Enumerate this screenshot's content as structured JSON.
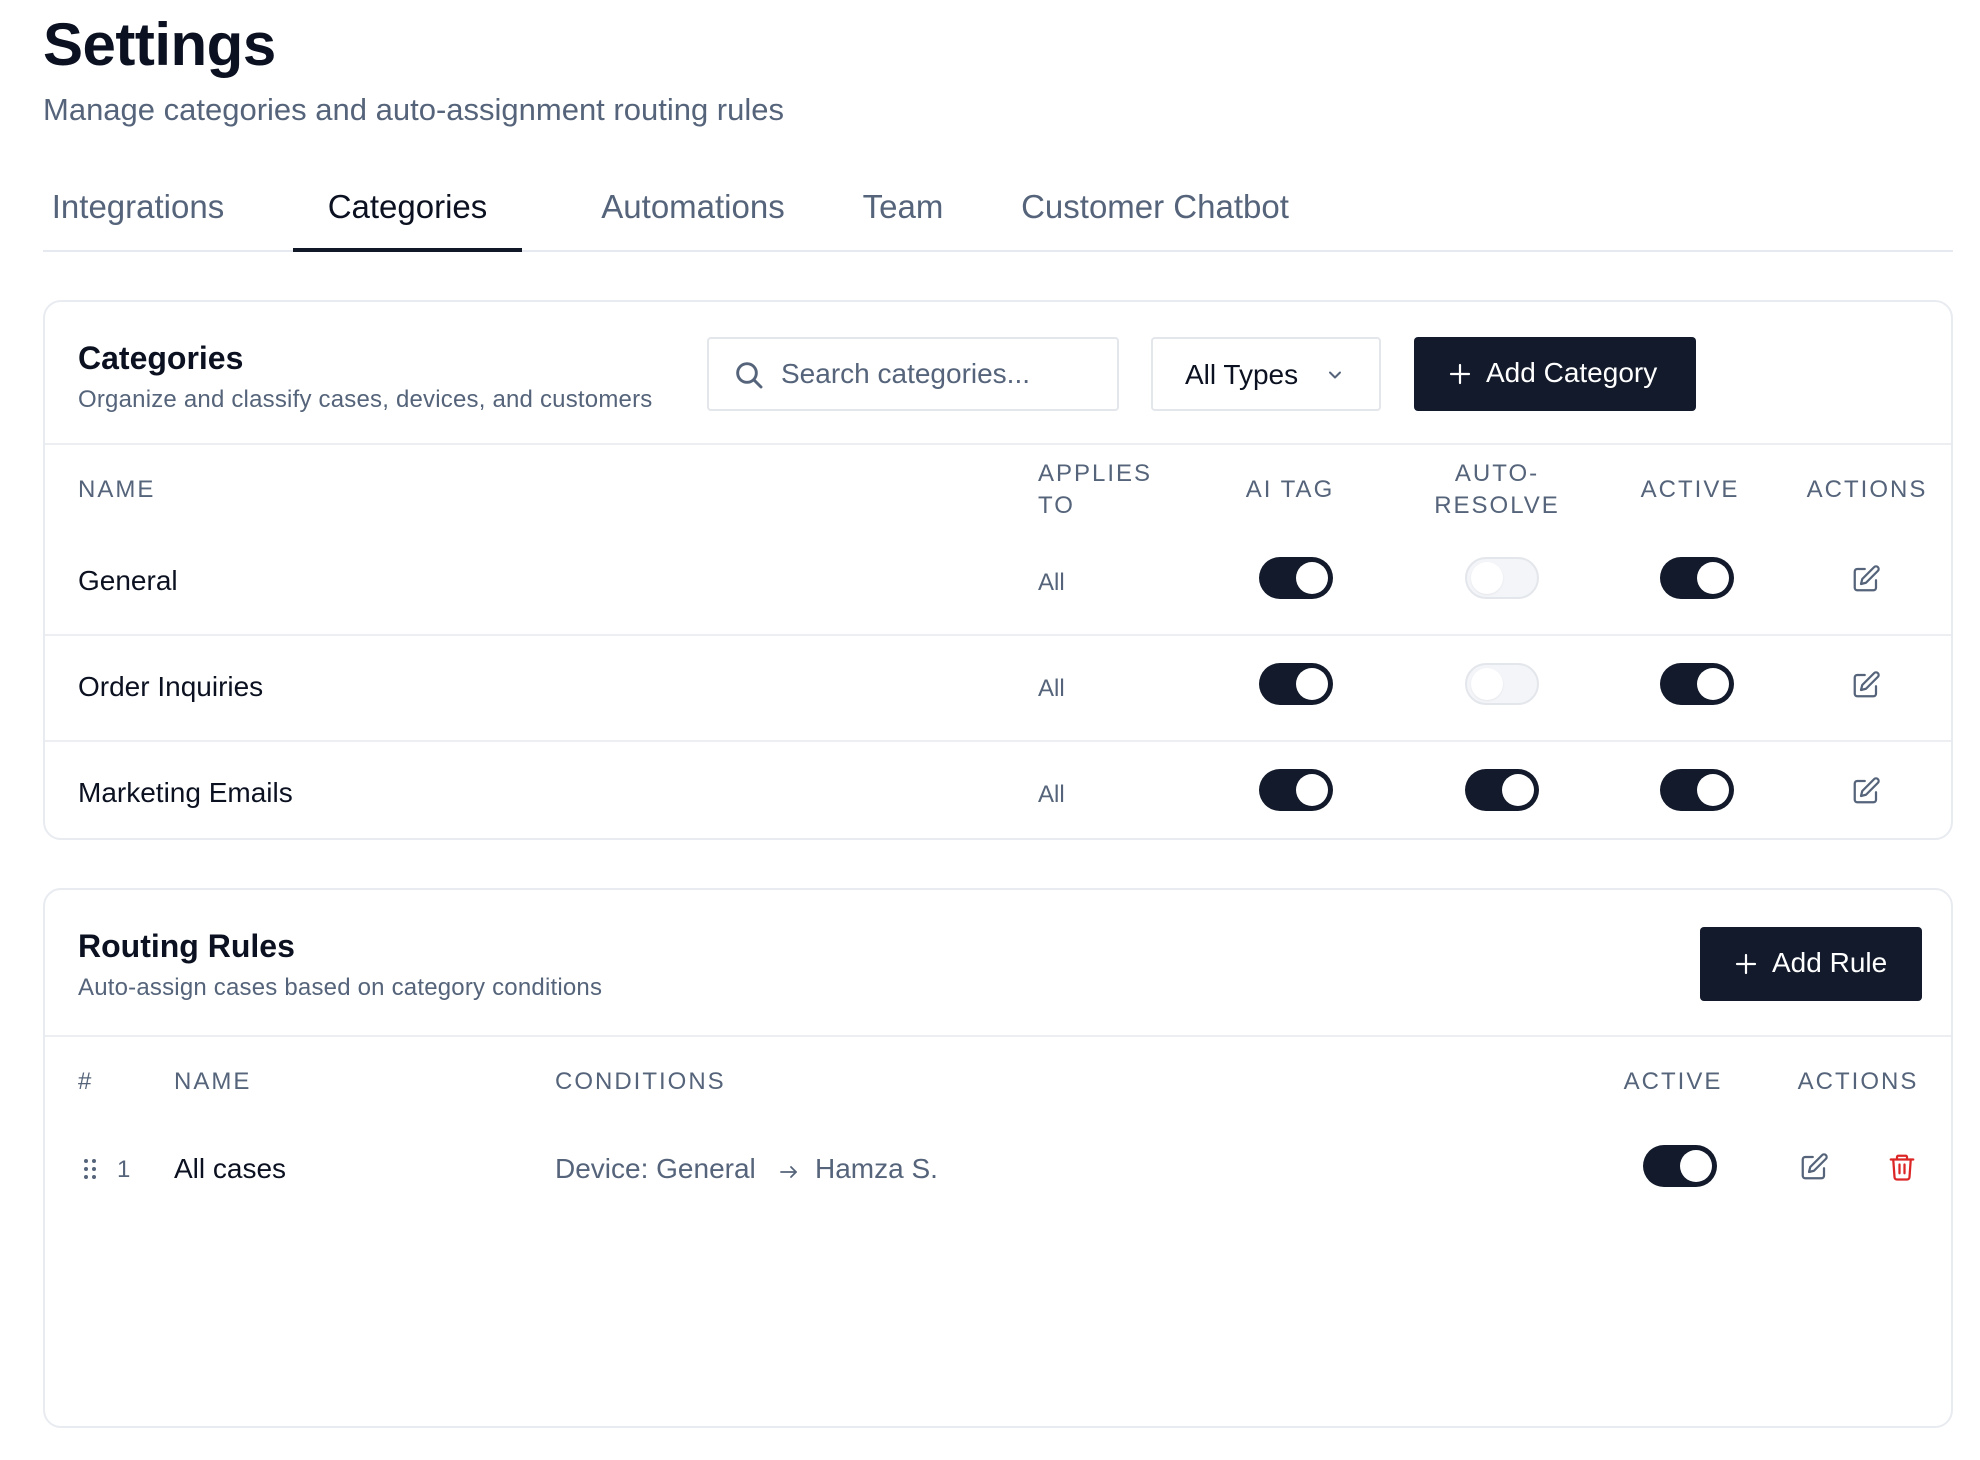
{
  "header": {
    "title": "Settings",
    "subtitle": "Manage categories and auto-assignment routing rules"
  },
  "tabs": [
    {
      "label": "Integrations",
      "active": false
    },
    {
      "label": "Categories",
      "active": true
    },
    {
      "label": "Automations",
      "active": false
    },
    {
      "label": "Team",
      "active": false
    },
    {
      "label": "Customer Chatbot",
      "active": false
    }
  ],
  "categories": {
    "title": "Categories",
    "subtitle": "Organize and classify cases, devices, and customers",
    "search_placeholder": "Search categories...",
    "type_filter": "All Types",
    "add_button": "Add Category",
    "columns": {
      "name": "NAME",
      "applies_to": "APPLIES TO",
      "ai_tag": "AI TAG",
      "auto_resolve": "AUTO-RESOLVE",
      "active": "ACTIVE",
      "actions": "ACTIONS"
    },
    "rows": [
      {
        "name": "General",
        "applies_to": "All",
        "ai_tag": true,
        "auto_resolve": false,
        "active": true
      },
      {
        "name": "Order Inquiries",
        "applies_to": "All",
        "ai_tag": true,
        "auto_resolve": false,
        "active": true
      },
      {
        "name": "Marketing Emails",
        "applies_to": "All",
        "ai_tag": true,
        "auto_resolve": true,
        "active": true
      }
    ]
  },
  "routing": {
    "title": "Routing Rules",
    "subtitle": "Auto-assign cases based on category conditions",
    "add_button": "Add Rule",
    "columns": {
      "index": "#",
      "name": "NAME",
      "conditions": "CONDITIONS",
      "active": "ACTIVE",
      "actions": "ACTIONS"
    },
    "rows": [
      {
        "index": "1",
        "name": "All cases",
        "condition": "Device: General",
        "assignee": "Hamza S.",
        "active": true
      }
    ]
  },
  "colors": {
    "primary": "#121a2b",
    "muted_text": "#55647a",
    "danger": "#dc2626",
    "border": "#e8ebf0"
  }
}
